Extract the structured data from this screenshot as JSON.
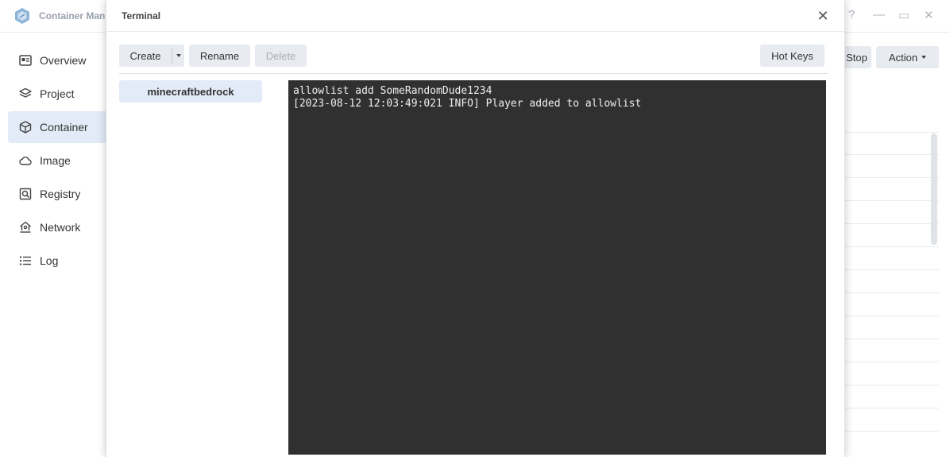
{
  "app": {
    "title": "Container Man",
    "help_glyph": "?",
    "minimize_glyph": "—",
    "maximize_glyph": "▭",
    "close_glyph": "✕"
  },
  "sidebar": {
    "items": [
      {
        "label": "Overview",
        "icon": "overview-icon"
      },
      {
        "label": "Project",
        "icon": "layers-icon"
      },
      {
        "label": "Container",
        "icon": "cube-icon",
        "active": true
      },
      {
        "label": "Image",
        "icon": "cloud-icon"
      },
      {
        "label": "Registry",
        "icon": "registry-search-icon"
      },
      {
        "label": "Network",
        "icon": "network-house-icon"
      },
      {
        "label": "Log",
        "icon": "list-icon"
      }
    ]
  },
  "background_toolbar": {
    "stop_label": "Stop",
    "action_label": "Action"
  },
  "modal": {
    "title": "Terminal",
    "close_glyph": "✕",
    "toolbar": {
      "create_label": "Create",
      "rename_label": "Rename",
      "delete_label": "Delete",
      "hotkeys_label": "Hot Keys"
    },
    "sessions": [
      {
        "name": "minecraftbedrock",
        "selected": true
      }
    ],
    "terminal": {
      "lines": [
        "allowlist add SomeRandomDude1234",
        "[2023-08-12 12:03:49:021 INFO] Player added to allowlist"
      ]
    }
  },
  "colors": {
    "accent_selected": "#e2ebf7",
    "terminal_bg": "#303030",
    "terminal_fg": "#f0f0f0",
    "button_bg": "#e8ebef"
  }
}
